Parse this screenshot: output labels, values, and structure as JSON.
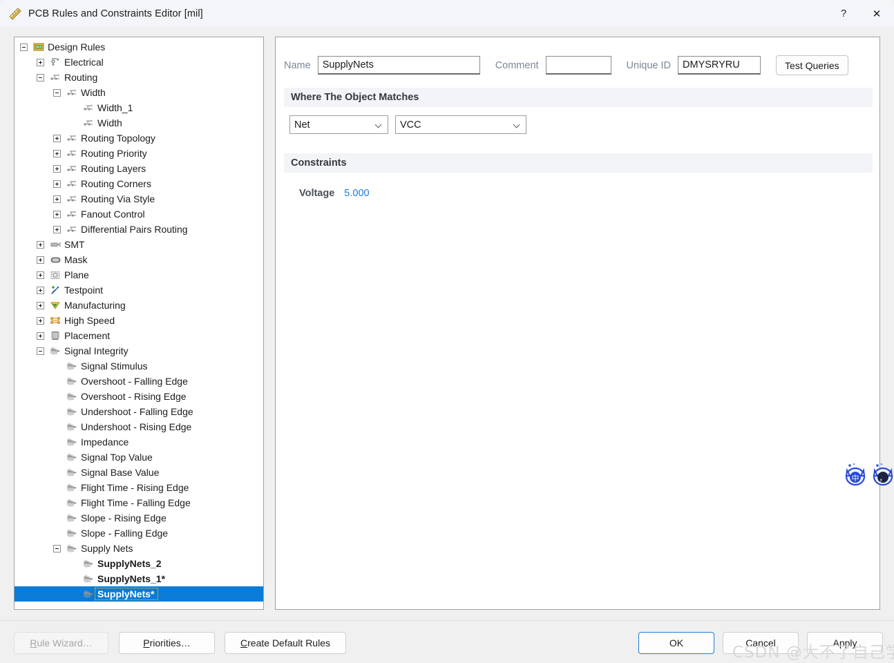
{
  "window": {
    "title": "PCB Rules and Constraints Editor [mil]",
    "icon": "ruler-icon",
    "help_label": "?",
    "close_label": "✕"
  },
  "tree": {
    "nodes": [
      {
        "label": "Design Rules",
        "indent": 0,
        "toggle": "minus",
        "icon": "design-rules-icon"
      },
      {
        "label": "Electrical",
        "indent": 1,
        "toggle": "plus",
        "icon": "electrical-icon"
      },
      {
        "label": "Routing",
        "indent": 1,
        "toggle": "minus",
        "icon": "routing-icon"
      },
      {
        "label": "Width",
        "indent": 2,
        "toggle": "minus",
        "icon": "routing-icon"
      },
      {
        "label": "Width_1",
        "indent": 3,
        "toggle": "none",
        "icon": "routing-icon"
      },
      {
        "label": "Width",
        "indent": 3,
        "toggle": "none",
        "icon": "routing-icon"
      },
      {
        "label": "Routing Topology",
        "indent": 2,
        "toggle": "plus",
        "icon": "routing-icon"
      },
      {
        "label": "Routing Priority",
        "indent": 2,
        "toggle": "plus",
        "icon": "routing-icon"
      },
      {
        "label": "Routing Layers",
        "indent": 2,
        "toggle": "plus",
        "icon": "routing-icon"
      },
      {
        "label": "Routing Corners",
        "indent": 2,
        "toggle": "plus",
        "icon": "routing-icon"
      },
      {
        "label": "Routing Via Style",
        "indent": 2,
        "toggle": "plus",
        "icon": "routing-icon"
      },
      {
        "label": "Fanout Control",
        "indent": 2,
        "toggle": "plus",
        "icon": "routing-icon"
      },
      {
        "label": "Differential Pairs Routing",
        "indent": 2,
        "toggle": "plus",
        "icon": "routing-icon"
      },
      {
        "label": "SMT",
        "indent": 1,
        "toggle": "plus",
        "icon": "smt-icon"
      },
      {
        "label": "Mask",
        "indent": 1,
        "toggle": "plus",
        "icon": "mask-icon"
      },
      {
        "label": "Plane",
        "indent": 1,
        "toggle": "plus",
        "icon": "plane-icon"
      },
      {
        "label": "Testpoint",
        "indent": 1,
        "toggle": "plus",
        "icon": "testpoint-icon"
      },
      {
        "label": "Manufacturing",
        "indent": 1,
        "toggle": "plus",
        "icon": "manufacturing-icon"
      },
      {
        "label": "High Speed",
        "indent": 1,
        "toggle": "plus",
        "icon": "highspeed-icon"
      },
      {
        "label": "Placement",
        "indent": 1,
        "toggle": "plus",
        "icon": "placement-icon"
      },
      {
        "label": "Signal Integrity",
        "indent": 1,
        "toggle": "minus",
        "icon": "signal-icon"
      },
      {
        "label": "Signal Stimulus",
        "indent": 2,
        "toggle": "none",
        "icon": "signal-icon"
      },
      {
        "label": "Overshoot - Falling Edge",
        "indent": 2,
        "toggle": "none",
        "icon": "signal-icon"
      },
      {
        "label": "Overshoot - Rising Edge",
        "indent": 2,
        "toggle": "none",
        "icon": "signal-icon"
      },
      {
        "label": "Undershoot - Falling Edge",
        "indent": 2,
        "toggle": "none",
        "icon": "signal-icon"
      },
      {
        "label": "Undershoot - Rising Edge",
        "indent": 2,
        "toggle": "none",
        "icon": "signal-icon"
      },
      {
        "label": "Impedance",
        "indent": 2,
        "toggle": "none",
        "icon": "signal-icon"
      },
      {
        "label": "Signal Top Value",
        "indent": 2,
        "toggle": "none",
        "icon": "signal-icon"
      },
      {
        "label": "Signal Base Value",
        "indent": 2,
        "toggle": "none",
        "icon": "signal-icon"
      },
      {
        "label": "Flight Time - Rising Edge",
        "indent": 2,
        "toggle": "none",
        "icon": "signal-icon"
      },
      {
        "label": "Flight Time - Falling Edge",
        "indent": 2,
        "toggle": "none",
        "icon": "signal-icon"
      },
      {
        "label": "Slope - Rising Edge",
        "indent": 2,
        "toggle": "none",
        "icon": "signal-icon"
      },
      {
        "label": "Slope - Falling Edge",
        "indent": 2,
        "toggle": "none",
        "icon": "signal-icon"
      },
      {
        "label": "Supply Nets",
        "indent": 2,
        "toggle": "minus",
        "icon": "signal-icon"
      },
      {
        "label": "SupplyNets_2",
        "indent": 3,
        "toggle": "none",
        "icon": "signal-icon",
        "bold": true
      },
      {
        "label": "SupplyNets_1*",
        "indent": 3,
        "toggle": "none",
        "icon": "signal-icon",
        "bold": true
      },
      {
        "label": "SupplyNets*",
        "indent": 3,
        "toggle": "none",
        "icon": "signal-icon",
        "bold": true,
        "selected": true
      }
    ]
  },
  "form": {
    "name_label": "Name",
    "name_value": "SupplyNets",
    "comment_label": "Comment",
    "comment_value": "",
    "comment_placeholder": "",
    "unique_id_label": "Unique ID",
    "unique_id_value": "DMYSRYRU",
    "test_queries_label": "Test Queries",
    "where_section_title": "Where The Object Matches",
    "scope_kind": "Net",
    "scope_value": "VCC",
    "constraints_section_title": "Constraints",
    "voltage_label": "Voltage",
    "voltage_value": "5.000"
  },
  "footer": {
    "rule_wizard": {
      "pre": "R",
      "rest": "ule Wizard…"
    },
    "priorities": {
      "pre": "P",
      "rest": "riorities…"
    },
    "create_default_rules": {
      "pre": "C",
      "rest": "reate Default Rules"
    },
    "ok": "OK",
    "cancel": "Cancel",
    "apply": "Apply"
  },
  "watermark": {
    "text": "CSDN @大不了自己学啰"
  },
  "ime": {
    "mode_label": "中",
    "punct_label": "，"
  },
  "colors": {
    "selection_blue": "#0a7bd6",
    "value_blue": "#1f7bd6",
    "band_grey": "#f2f4f7",
    "titlebar": "#f3f5f9"
  }
}
